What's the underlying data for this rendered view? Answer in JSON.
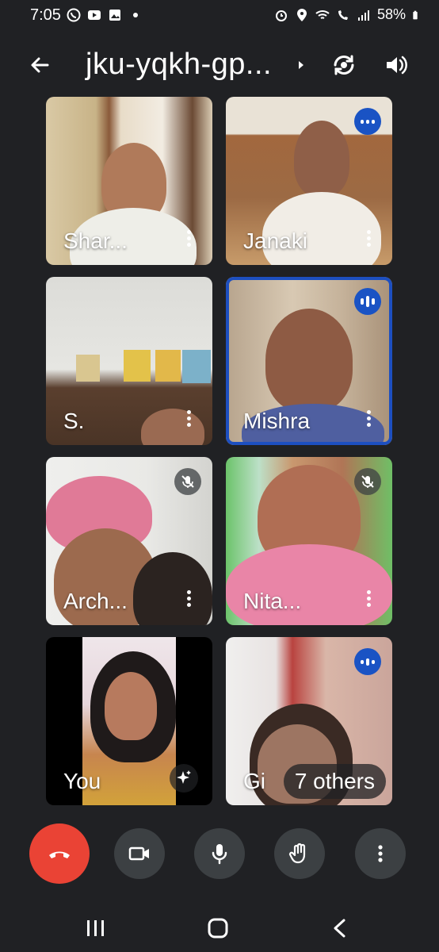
{
  "status_bar": {
    "time": "7:05",
    "battery": "58%",
    "left_icons": [
      "whatsapp-icon",
      "youtube-icon",
      "gallery-icon",
      "notification-dot"
    ],
    "right_icons": [
      "alarm-icon",
      "location-icon",
      "wifi-icon",
      "wifi-calling-icon",
      "signal-icon",
      "battery-icon"
    ]
  },
  "header": {
    "meeting_code": "jku-yqkh-gp...",
    "icons": [
      "back-arrow-icon",
      "meeting-info-caret-icon",
      "switch-camera-icon",
      "speaker-icon"
    ]
  },
  "tiles": [
    {
      "name": "Shar...",
      "state": "normal"
    },
    {
      "name": "Janaki",
      "state": "speaking"
    },
    {
      "name": "S.",
      "state": "normal"
    },
    {
      "name": "Mishra",
      "state": "speaking-active"
    },
    {
      "name": "Arch...",
      "state": "muted"
    },
    {
      "name": "Nita...",
      "state": "muted"
    },
    {
      "name": "You",
      "state": "self"
    },
    {
      "name": "Gi",
      "state": "speaking",
      "others_label": "7 others"
    }
  ],
  "controls": [
    "end-call-icon",
    "camera-icon",
    "microphone-icon",
    "raise-hand-icon",
    "more-options-icon"
  ],
  "colors": {
    "background": "#202124",
    "end_call": "#ea4335",
    "control_button": "#3c4043",
    "speaking_accent": "#1a53c4"
  }
}
